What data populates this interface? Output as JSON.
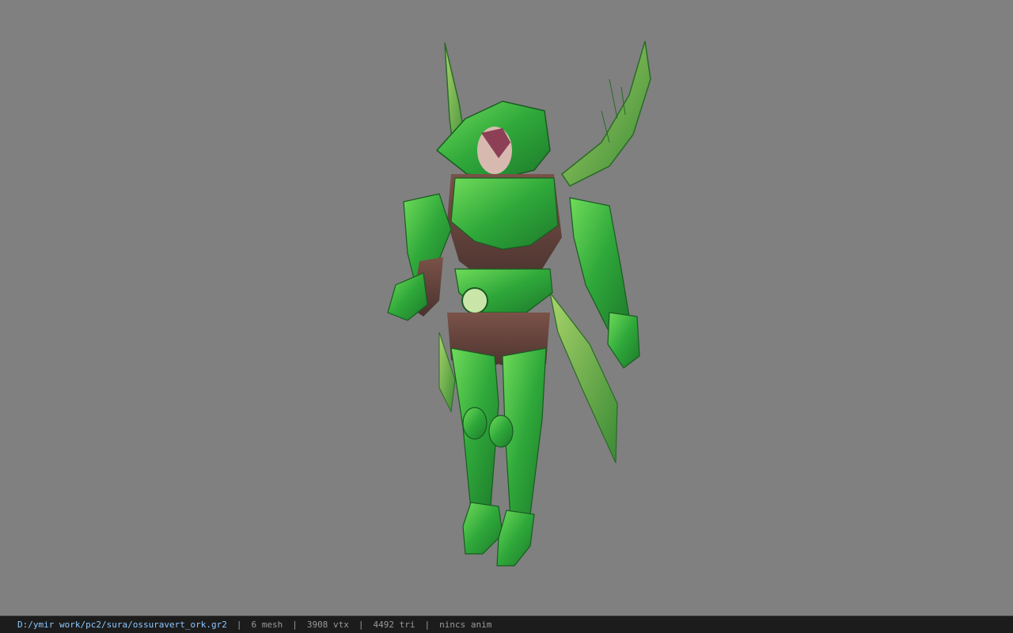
{
  "viewer": {
    "background_color": "#808080",
    "model_icon": "armored-character-model"
  },
  "status_bar": {
    "file_path": "D:/ymir work/pc2/sura/ossuravert_ork.gr2",
    "separator": "|",
    "mesh": "6 mesh",
    "vertices": "3908 vtx",
    "triangles": "4492 tri",
    "anim": "nincs anim"
  }
}
